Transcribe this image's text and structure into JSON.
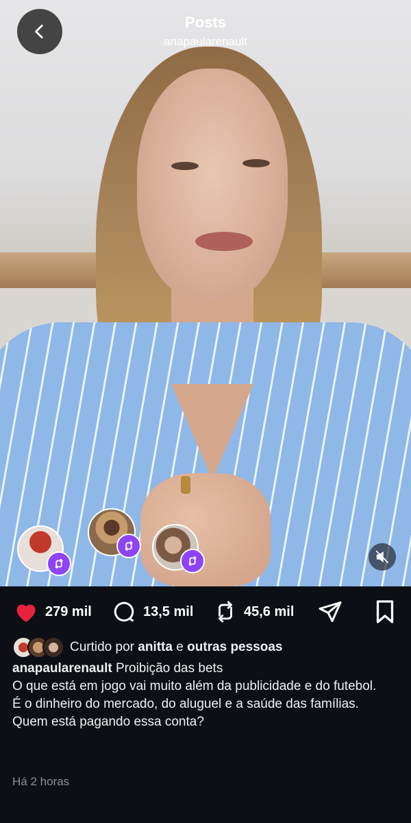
{
  "header": {
    "title": "Posts",
    "username": "anapaularenault"
  },
  "actions": {
    "likes": "279 mil",
    "comments": "13,5 mil",
    "reposts": "45,6 mil"
  },
  "liked_by": {
    "prefix": "Curtido por",
    "user": "anitta",
    "connector": "e",
    "others": "outras pessoas"
  },
  "caption": {
    "username": "anapaularenault",
    "lines": [
      "Proibição das bets",
      "O que está em jogo vai muito além da publicidade e do futebol.",
      "É o dinheiro do mercado, do aluguel e a saúde das famílias.",
      "Quem está pagando essa conta?"
    ]
  },
  "timestamp": "Há 2 horas",
  "colors": {
    "like_red": "#e8223c",
    "remix_purple": "#8e44f5",
    "panel_bg": "#0c0f14"
  },
  "icons": [
    "back-icon",
    "heart-icon",
    "comment-icon",
    "repost-icon",
    "share-icon",
    "bookmark-icon",
    "mute-icon",
    "remix-icon"
  ]
}
